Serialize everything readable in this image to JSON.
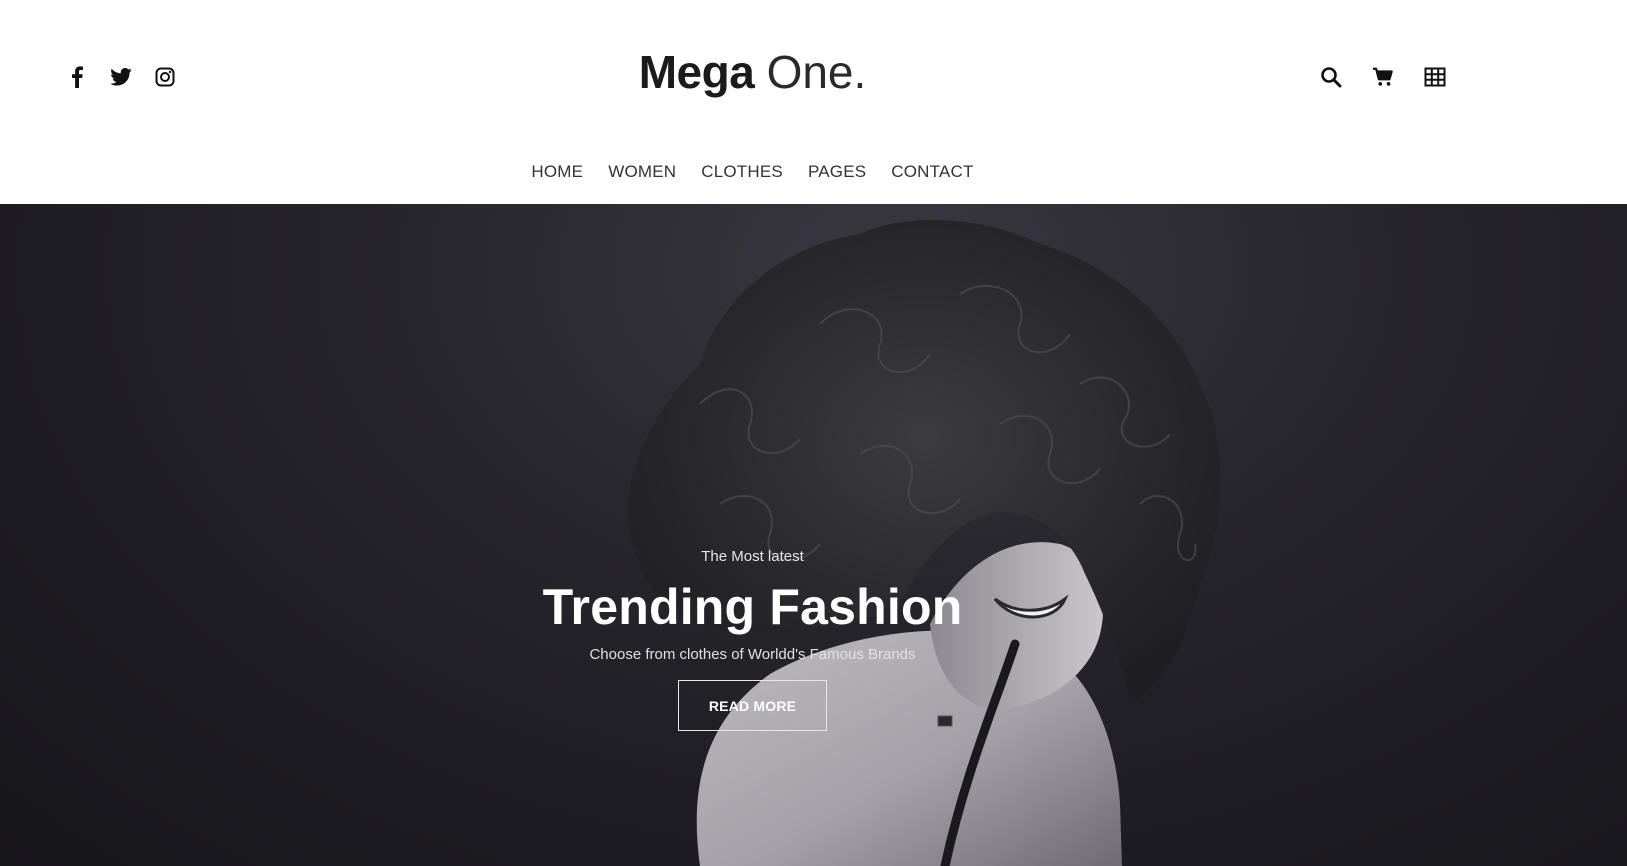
{
  "header": {
    "social": [
      {
        "name": "facebook-icon"
      },
      {
        "name": "twitter-icon"
      },
      {
        "name": "instagram-icon"
      }
    ],
    "logo": {
      "bold": "Mega",
      "light": "One."
    },
    "tools": [
      {
        "name": "search-icon"
      },
      {
        "name": "cart-icon"
      },
      {
        "name": "grid-menu-icon"
      }
    ],
    "nav": [
      "HOME",
      "WOMEN",
      "CLOTHES",
      "PAGES",
      "CONTACT"
    ]
  },
  "hero": {
    "kicker": "The Most latest",
    "headline": "Trending Fashion",
    "subline": "Choose from clothes of Worldd's Famous Brands",
    "cta_label": "READ MORE"
  },
  "colors": {
    "header_bg": "#ffffff",
    "text_dark": "#1b1b1b",
    "nav_text": "#333333",
    "hero_bg": "#1c1b21",
    "hero_text": "#ffffff"
  }
}
